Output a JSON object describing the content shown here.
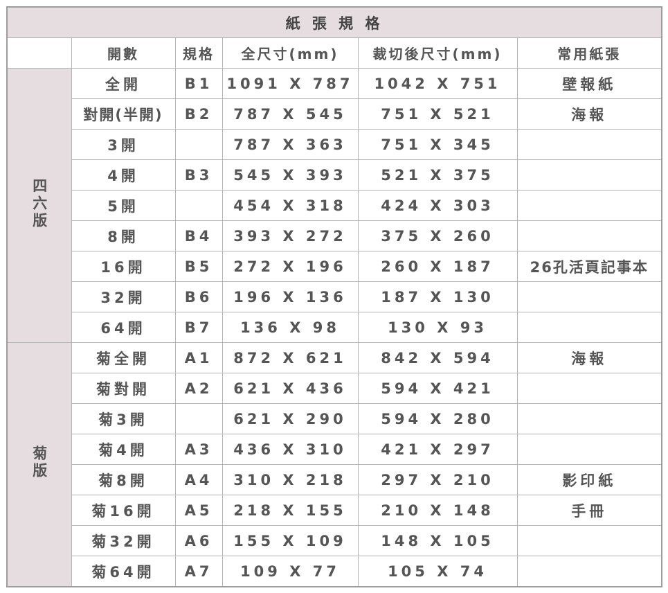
{
  "title": "紙 張 規 格",
  "headers": {
    "blank": "",
    "open": "開數",
    "spec": "規格",
    "full": "全尺寸(mm)",
    "cut": "裁切後尺寸(mm)",
    "common": "常用紙張"
  },
  "groups": [
    {
      "label": "四六版",
      "rows": [
        {
          "open": "全開",
          "spec": "B1",
          "full": "1091 X 787",
          "cut": "1042 X 751",
          "common": "壁報紙"
        },
        {
          "open": "對開(半開)",
          "spec": "B2",
          "full": "787 X 545",
          "cut": "751 X 521",
          "common": "海報"
        },
        {
          "open": "3開",
          "spec": "",
          "full": "787 X 363",
          "cut": "751 X 345",
          "common": ""
        },
        {
          "open": "4開",
          "spec": "B3",
          "full": "545 X 393",
          "cut": "521 X 375",
          "common": ""
        },
        {
          "open": "5開",
          "spec": "",
          "full": "454 X 318",
          "cut": "424 X 303",
          "common": ""
        },
        {
          "open": "8開",
          "spec": "B4",
          "full": "393 X 272",
          "cut": "375 X 260",
          "common": ""
        },
        {
          "open": "16開",
          "spec": "B5",
          "full": "272 X 196",
          "cut": "260 X 187",
          "common": "26孔活頁記事本"
        },
        {
          "open": "32開",
          "spec": "B6",
          "full": "196 X 136",
          "cut": "187 X 130",
          "common": ""
        },
        {
          "open": "64開",
          "spec": "B7",
          "full": "136 X 98",
          "cut": "130 X 93",
          "common": ""
        }
      ]
    },
    {
      "label": "菊版",
      "rows": [
        {
          "open": "菊全開",
          "spec": "A1",
          "full": "872 X 621",
          "cut": "842 X 594",
          "common": "海報"
        },
        {
          "open": "菊對開",
          "spec": "A2",
          "full": "621 X 436",
          "cut": "594 X 421",
          "common": ""
        },
        {
          "open": "菊3開",
          "spec": "",
          "full": "621 X 290",
          "cut": "594 X 280",
          "common": ""
        },
        {
          "open": "菊4開",
          "spec": "A3",
          "full": "436 X 310",
          "cut": "421 X 297",
          "common": ""
        },
        {
          "open": "菊8開",
          "spec": "A4",
          "full": "310 X 218",
          "cut": "297 X 210",
          "common": "影印紙"
        },
        {
          "open": "菊16開",
          "spec": "A5",
          "full": "218 X 155",
          "cut": "210 X 148",
          "common": "手冊"
        },
        {
          "open": "菊32開",
          "spec": "A6",
          "full": "155 X 109",
          "cut": "148 X 105",
          "common": ""
        },
        {
          "open": "菊64開",
          "spec": "A7",
          "full": "109 X 77",
          "cut": "105 X 74",
          "common": ""
        }
      ]
    }
  ],
  "colors": {
    "header_bg": "#e6dde0",
    "border": "#b4b4b4",
    "text": "#555555"
  }
}
